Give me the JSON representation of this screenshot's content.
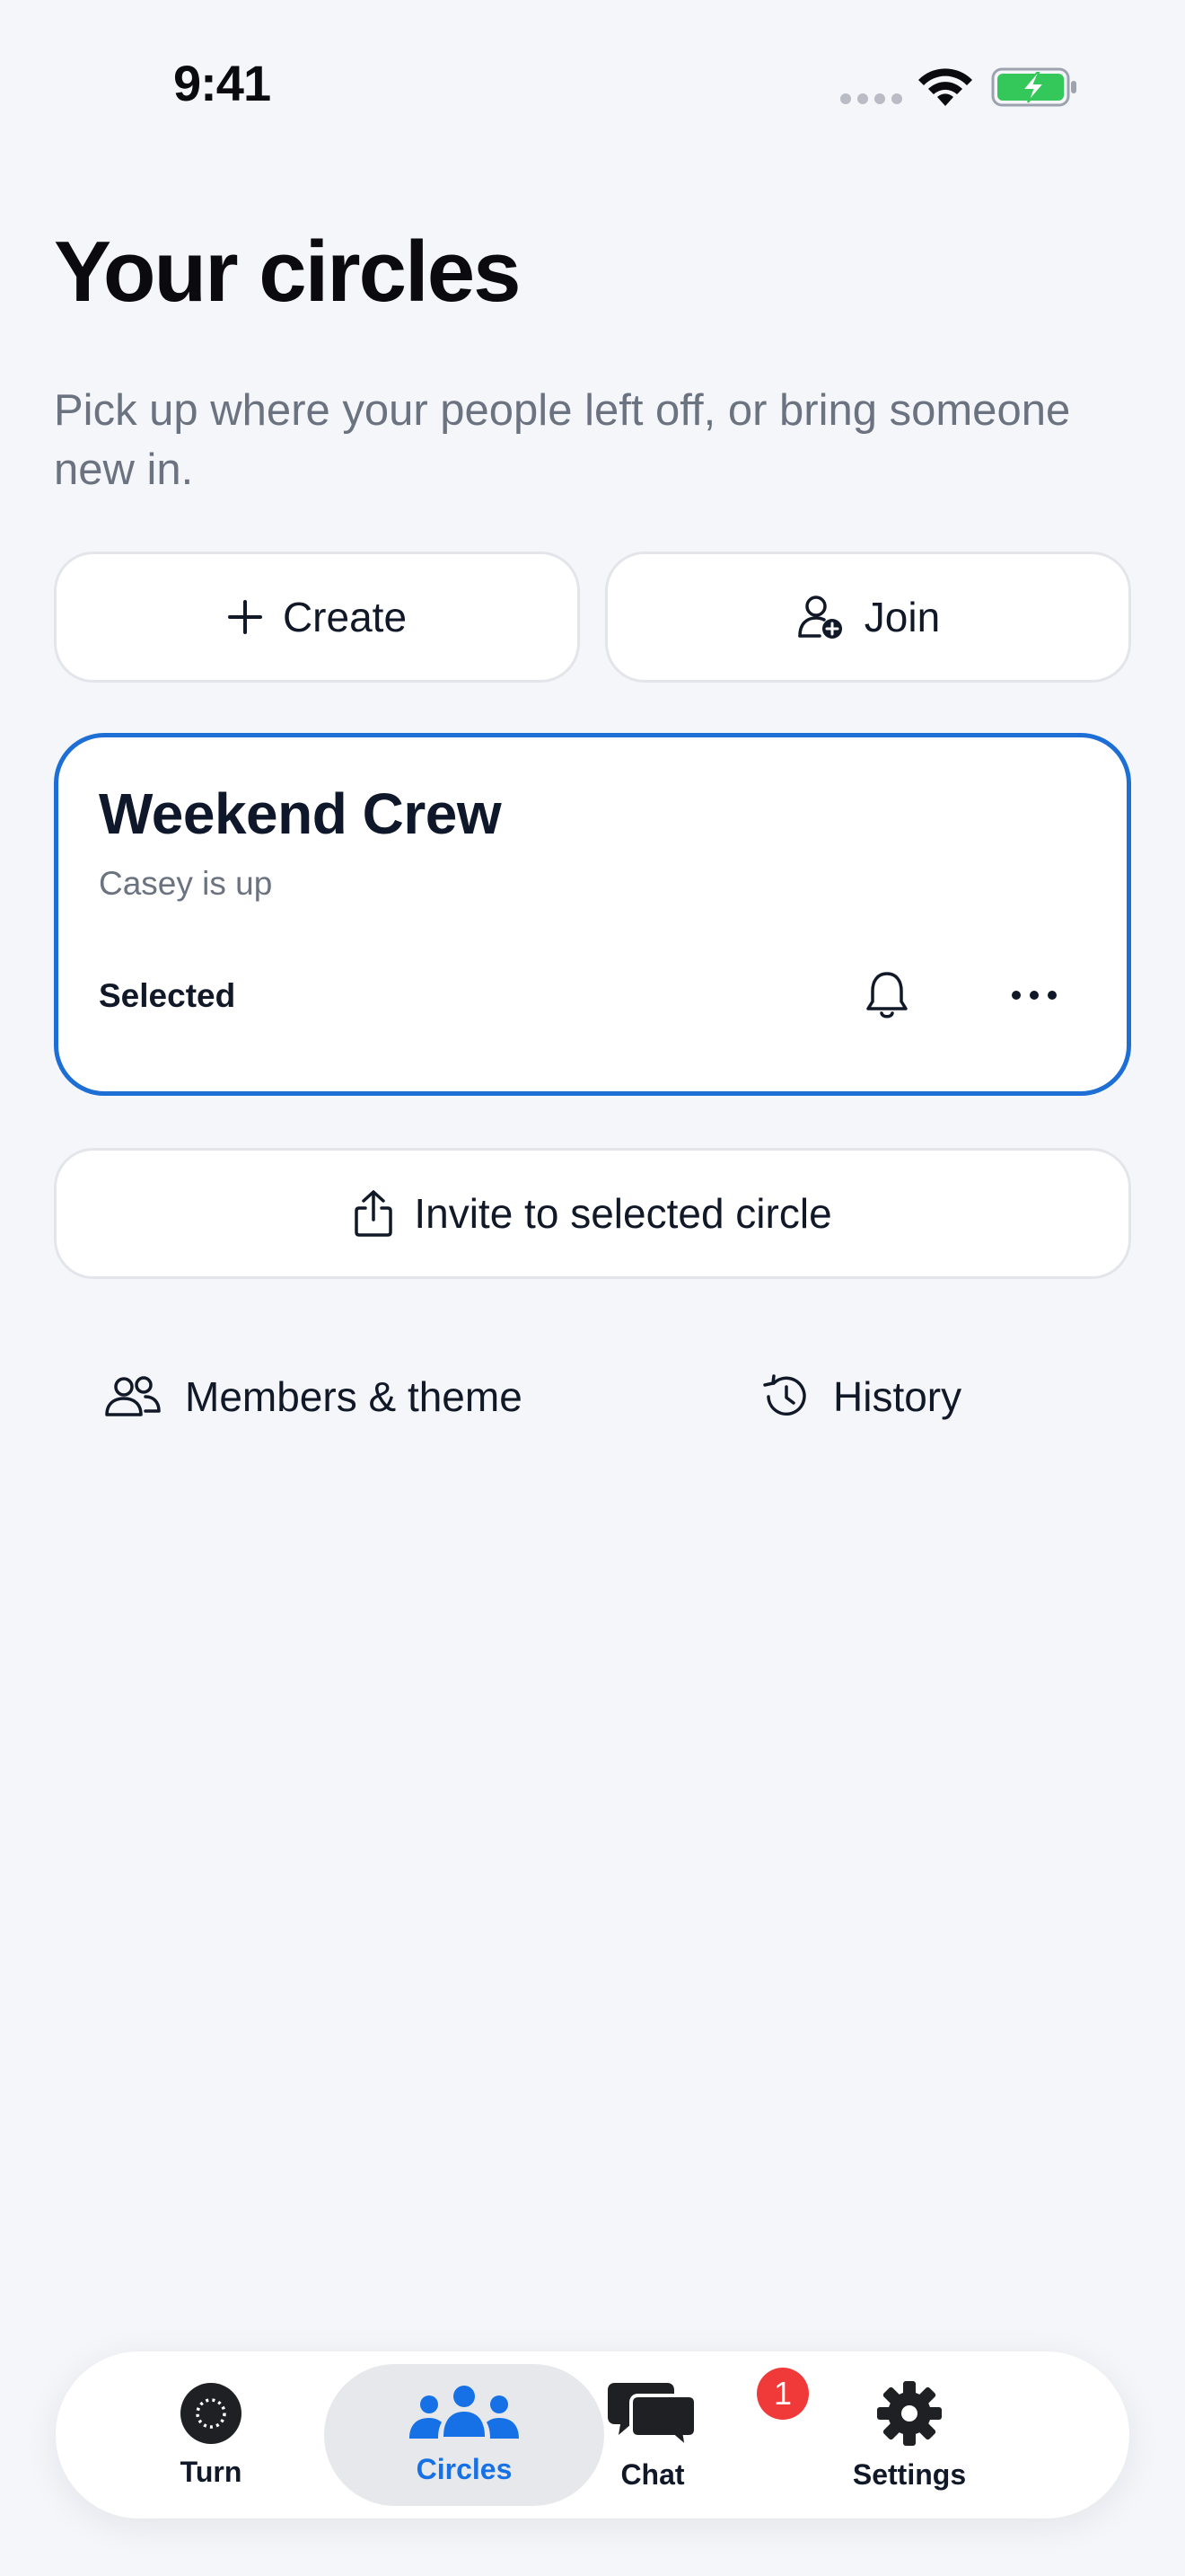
{
  "status_bar": {
    "time": "9:41"
  },
  "header": {
    "title": "Your circles",
    "subtitle": "Pick up where your people left off, or bring someone new in."
  },
  "actions": {
    "create_label": "Create",
    "join_label": "Join"
  },
  "circle": {
    "name": "Weekend Crew",
    "status": "Casey is up",
    "selected_label": "Selected"
  },
  "invite": {
    "label": "Invite to selected circle"
  },
  "links": {
    "members_label": "Members & theme",
    "history_label": "History"
  },
  "tab_bar": {
    "tabs": [
      {
        "label": "Turn",
        "icon": "turn-icon"
      },
      {
        "label": "Circles",
        "icon": "people-icon",
        "active": true
      },
      {
        "label": "Chat",
        "icon": "chat-bubbles-icon",
        "badge": "1"
      },
      {
        "label": "Settings",
        "icon": "gear-icon"
      }
    ]
  },
  "colors": {
    "accent": "#1671e6",
    "card_border": "#1d6fd6",
    "badge": "#f03a3a",
    "background": "#f5f6fa",
    "battery": "#34c759"
  }
}
